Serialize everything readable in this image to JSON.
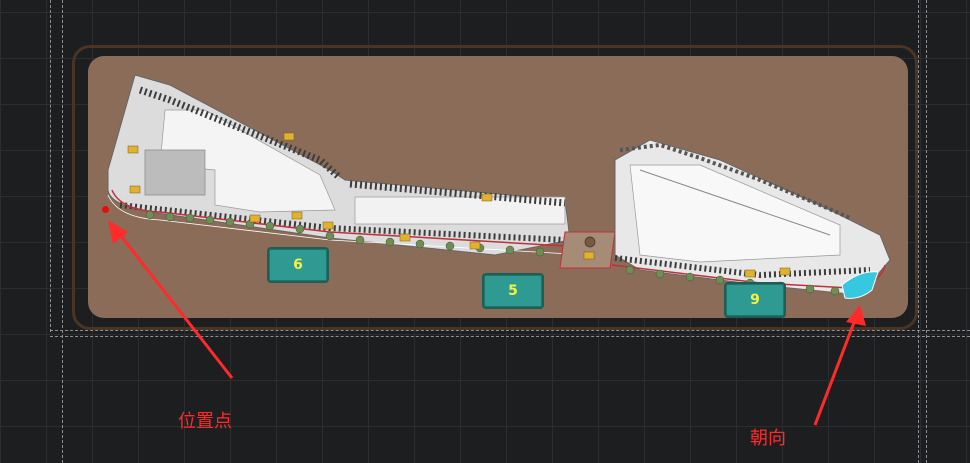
{
  "zones": [
    {
      "label": "6"
    },
    {
      "label": "5"
    },
    {
      "label": "9"
    }
  ],
  "annotations": {
    "position_label": "位置点",
    "orientation_label": "朝向"
  },
  "colors": {
    "background": "#1d1e20",
    "site": "#8b6c58",
    "zone_fill": "#2e9a91",
    "zone_text": "#f3f246",
    "annotation": "#ff2b2b"
  }
}
